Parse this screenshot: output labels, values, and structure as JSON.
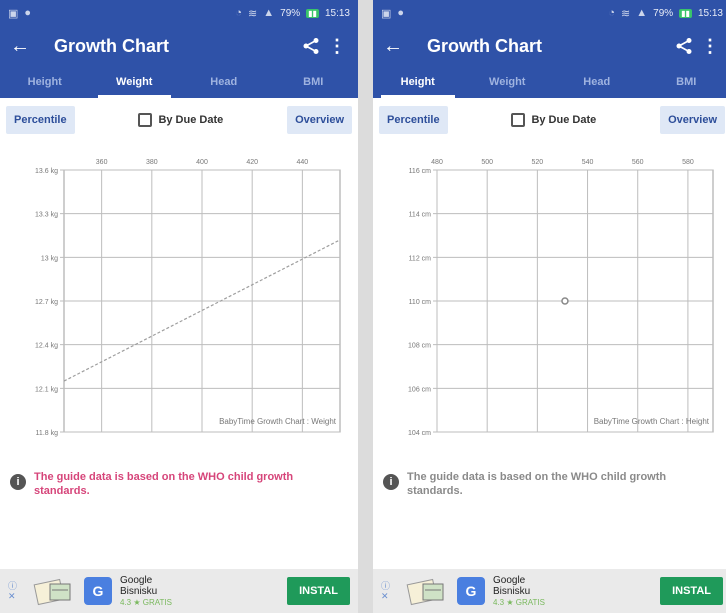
{
  "colors": {
    "primary": "#2f52a8",
    "tab_inactive": "#9fb3e0",
    "button_bg": "#dfe8f6",
    "notice_pink": "#d6457a",
    "notice_gray": "#8a8a8a",
    "install_green": "#1f9a5a",
    "line": "#bdbdbd"
  },
  "left": {
    "status": {
      "time": "15:13",
      "battery_percent": "79%"
    },
    "title": "Growth Chart",
    "tabs": [
      {
        "label": "Height",
        "active": false
      },
      {
        "label": "Weight",
        "active": true
      },
      {
        "label": "Head",
        "active": false
      },
      {
        "label": "BMI",
        "active": false
      }
    ],
    "percentile_label": "Percentile",
    "due_date_label": "By Due Date",
    "overview_label": "Overview",
    "notice": "The guide data is based on the WHO child growth standards.",
    "ad": {
      "name_line1": "Google",
      "name_line2": "Bisnisku",
      "rating": "4.3 ★ GRATIS",
      "install_label": "INSTAL"
    }
  },
  "right": {
    "status": {
      "time": "15:13",
      "battery_percent": "79%"
    },
    "title": "Growth Chart",
    "tabs": [
      {
        "label": "Height",
        "active": true
      },
      {
        "label": "Weight",
        "active": false
      },
      {
        "label": "Head",
        "active": false
      },
      {
        "label": "BMI",
        "active": false
      }
    ],
    "percentile_label": "Percentile",
    "due_date_label": "By Due Date",
    "overview_label": "Overview",
    "notice": "The guide data is based on the WHO child growth standards.",
    "ad": {
      "name_line1": "Google",
      "name_line2": "Bisnisku",
      "rating": "4.3 ★ GRATIS",
      "install_label": "INSTAL"
    }
  },
  "chart_data": [
    {
      "type": "line",
      "watermark": "BabyTime Growth Chart : Weight",
      "x_ticks": [
        360,
        380,
        400,
        420,
        440
      ],
      "y_ticks": [
        "13.6 kg",
        "13.3 kg",
        "13 kg",
        "12.7 kg",
        "12.4 kg",
        "12.1 kg",
        "11.8 kg"
      ],
      "xlim": [
        345,
        455
      ],
      "ylim": [
        11.8,
        13.6
      ],
      "y_tick_values": [
        13.6,
        13.3,
        13.0,
        12.7,
        12.4,
        12.1,
        11.8
      ],
      "series": [
        {
          "values": [
            {
              "x": 345,
              "y": 12.15
            },
            {
              "x": 455,
              "y": 13.12
            }
          ],
          "style": "dashed"
        }
      ],
      "grid": true
    },
    {
      "type": "scatter",
      "watermark": "BabyTime Growth Chart : Height",
      "x_ticks": [
        480,
        500,
        520,
        540,
        560,
        580
      ],
      "y_ticks": [
        "116 cm",
        "114 cm",
        "112 cm",
        "110 cm",
        "108 cm",
        "106 cm",
        "104 cm"
      ],
      "xlim": [
        480,
        590
      ],
      "ylim": [
        104,
        116
      ],
      "y_tick_values": [
        116,
        114,
        112,
        110,
        108,
        106,
        104
      ],
      "series": [
        {
          "values": [
            {
              "x": 531,
              "y": 110
            }
          ]
        }
      ],
      "grid": true
    }
  ]
}
